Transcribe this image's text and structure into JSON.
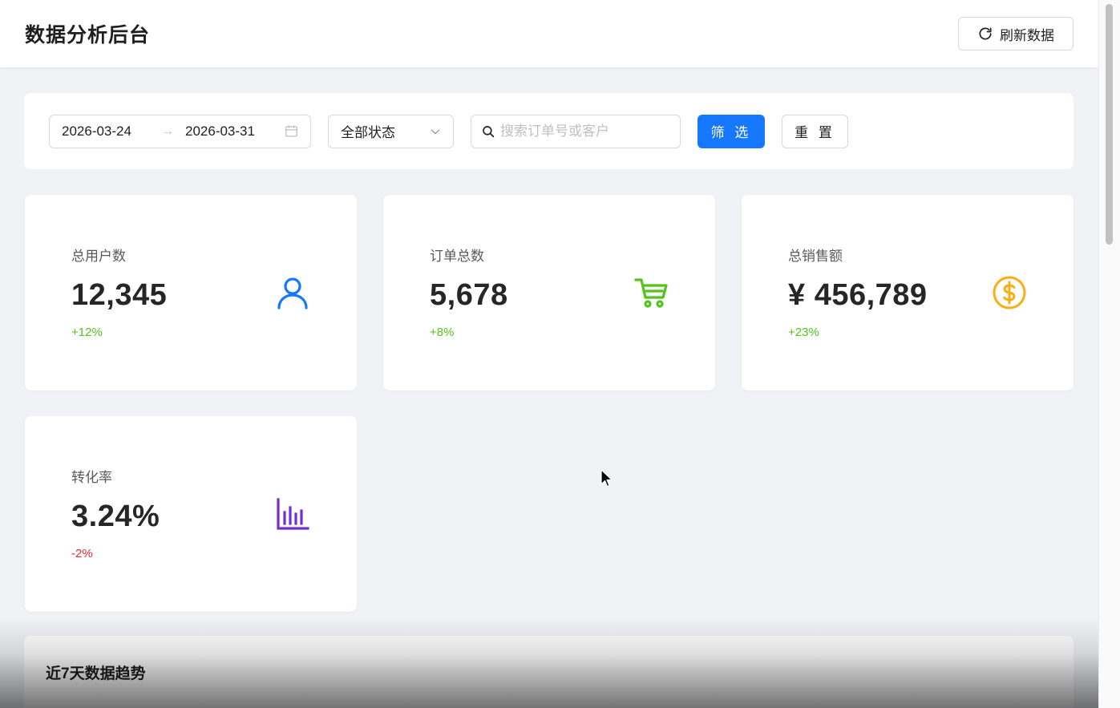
{
  "header": {
    "title": "数据分析后台",
    "refresh_label": "刷新数据",
    "refresh_icon": "refresh-icon"
  },
  "filters": {
    "start_date": "2026-03-24",
    "end_date": "2026-03-31",
    "range_separator": "→",
    "status_selected": "全部状态",
    "search_placeholder": "搜索订单号或客户",
    "search_value": "",
    "filter_label": "筛 选",
    "reset_label": "重 置"
  },
  "stats": [
    {
      "label": "总用户数",
      "value": "12,345",
      "change": "+12%",
      "trend": "up",
      "icon": "user-icon",
      "icon_color": "#1677ff"
    },
    {
      "label": "订单总数",
      "value": "5,678",
      "change": "+8%",
      "trend": "up",
      "icon": "shopping-cart-icon",
      "icon_color": "#52c41a"
    },
    {
      "label": "总销售额",
      "value": "¥ 456,789",
      "change": "+23%",
      "trend": "up",
      "icon": "dollar-circle-icon",
      "icon_color": "#faad14"
    },
    {
      "label": "转化率",
      "value": "3.24%",
      "change": "-2%",
      "trend": "down",
      "icon": "bar-chart-icon",
      "icon_color": "#722ed1"
    }
  ],
  "trend": {
    "title": "近7天数据趋势"
  },
  "colors": {
    "primary": "#1677ff",
    "up": "#52c41a",
    "down": "#f5222d",
    "background": "#f0f2f5"
  }
}
